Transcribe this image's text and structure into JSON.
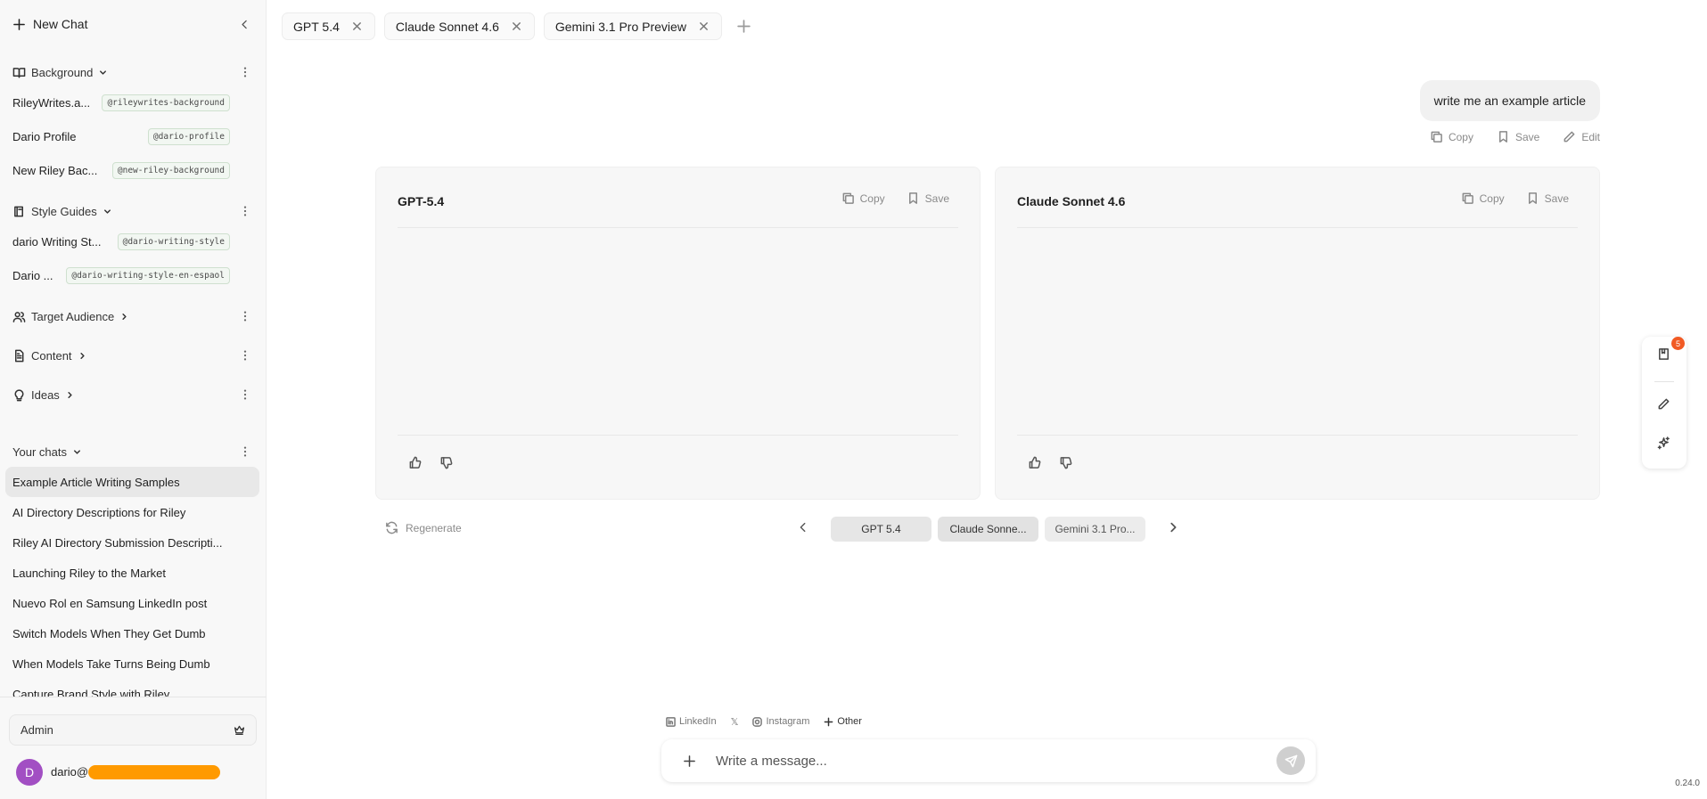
{
  "sidebar": {
    "new_chat": "New Chat",
    "sections": {
      "background": {
        "label": "Background",
        "items": [
          {
            "name": "RileyWrites.a...",
            "tag": "@rileywrites-background"
          },
          {
            "name": "Dario Profile",
            "tag": "@dario-profile"
          },
          {
            "name": "New Riley Bac...",
            "tag": "@new-riley-background"
          }
        ]
      },
      "style_guides": {
        "label": "Style Guides",
        "items": [
          {
            "name": "dario Writing St...",
            "tag": "@dario-writing-style"
          },
          {
            "name": "Dario ...",
            "tag": "@dario-writing-style-en-espaol"
          }
        ]
      },
      "target_audience": {
        "label": "Target Audience"
      },
      "content": {
        "label": "Content"
      },
      "ideas": {
        "label": "Ideas"
      }
    },
    "your_chats": {
      "label": "Your chats",
      "items": [
        "Example Article Writing Samples",
        "AI Directory Descriptions for Riley",
        "Riley AI Directory Submission Descripti...",
        "Launching Riley to the Market",
        "Nuevo Rol en Samsung LinkedIn post",
        "Switch Models When They Get Dumb",
        "When Models Take Turns Being Dumb",
        "Capture Brand Style with Riley"
      ]
    },
    "admin_label": "Admin",
    "user": {
      "initial": "D",
      "name_prefix": "dario@"
    }
  },
  "tabs": [
    "GPT 5.4",
    "Claude Sonnet 4.6",
    "Gemini 3.1 Pro Preview"
  ],
  "user_message": {
    "text": "write me an example article",
    "actions": {
      "copy": "Copy",
      "save": "Save",
      "edit": "Edit"
    }
  },
  "responses": [
    {
      "model": "GPT-5.4",
      "copy": "Copy",
      "save": "Save"
    },
    {
      "model": "Claude Sonnet 4.6",
      "copy": "Copy",
      "save": "Save"
    }
  ],
  "switcher": {
    "regenerate": "Regenerate",
    "models": [
      "GPT 5.4",
      "Claude Sonne...",
      "Gemini 3.1 Pro..."
    ]
  },
  "float_panel": {
    "badge": "5"
  },
  "composer": {
    "platforms": {
      "linkedin": "LinkedIn",
      "x": "𝕏",
      "instagram": "Instagram",
      "other": "Other"
    },
    "placeholder": "Write a message..."
  },
  "version": "0.24.0",
  "colors": {
    "avatar": "#a24fc3",
    "badge": "#f15a24",
    "redaction": "#ff9a00",
    "tag_border": "#cfe0cf"
  }
}
